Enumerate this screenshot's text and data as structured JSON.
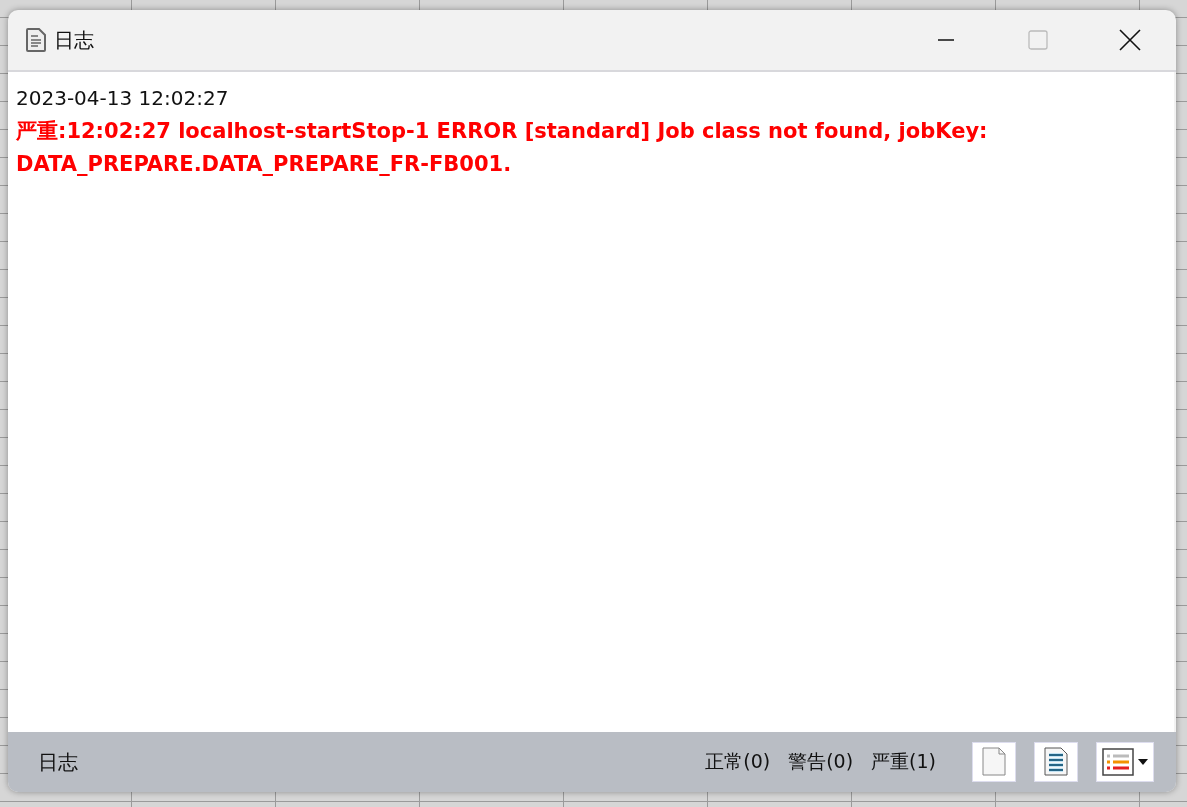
{
  "window": {
    "title": "日志"
  },
  "log": [
    {
      "kind": "timestamp",
      "text": "2023-04-13 12:02:27"
    },
    {
      "kind": "severe",
      "text": "严重:12:02:27 localhost-startStop-1 ERROR [standard] Job class not found, jobKey: DATA_PREPARE.DATA_PREPARE_FR-FB001."
    }
  ],
  "status_bar": {
    "label": "日志",
    "counts": [
      "正常(0)",
      "警告(0)",
      "严重(1)"
    ]
  }
}
